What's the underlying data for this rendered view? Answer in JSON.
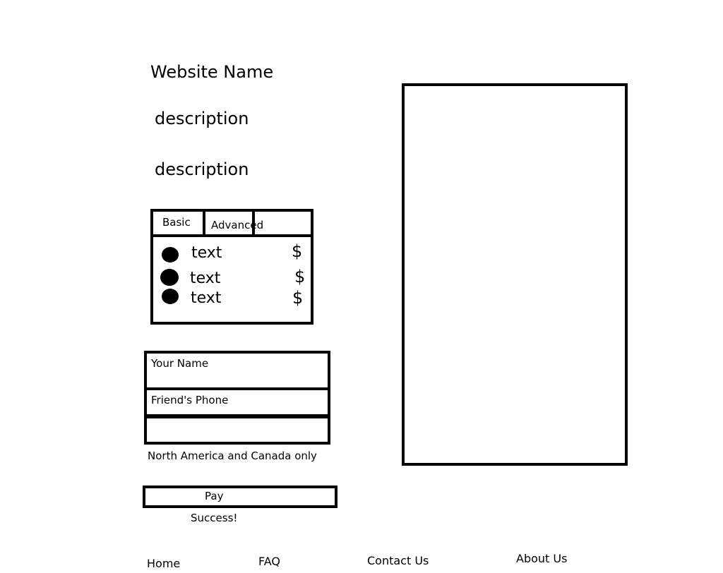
{
  "header": {
    "site_name": "Website Name",
    "descriptions": [
      "description",
      "description"
    ]
  },
  "plans": {
    "tabs": [
      {
        "label": "Basic"
      },
      {
        "label": "Advanced"
      }
    ],
    "options": [
      {
        "label": "text",
        "price": "$"
      },
      {
        "label": "text",
        "price": "$"
      },
      {
        "label": "text",
        "price": "$"
      }
    ]
  },
  "form": {
    "name_field": "Your Name",
    "phone_field": "Friend's Phone",
    "extra_field": "",
    "region_note": "North America and Canada only",
    "pay_label": "Pay",
    "status_text": "Success!"
  },
  "footer": {
    "links": [
      {
        "label": "Home"
      },
      {
        "label": "FAQ"
      },
      {
        "label": "Contact Us"
      },
      {
        "label": "About Us"
      }
    ]
  }
}
